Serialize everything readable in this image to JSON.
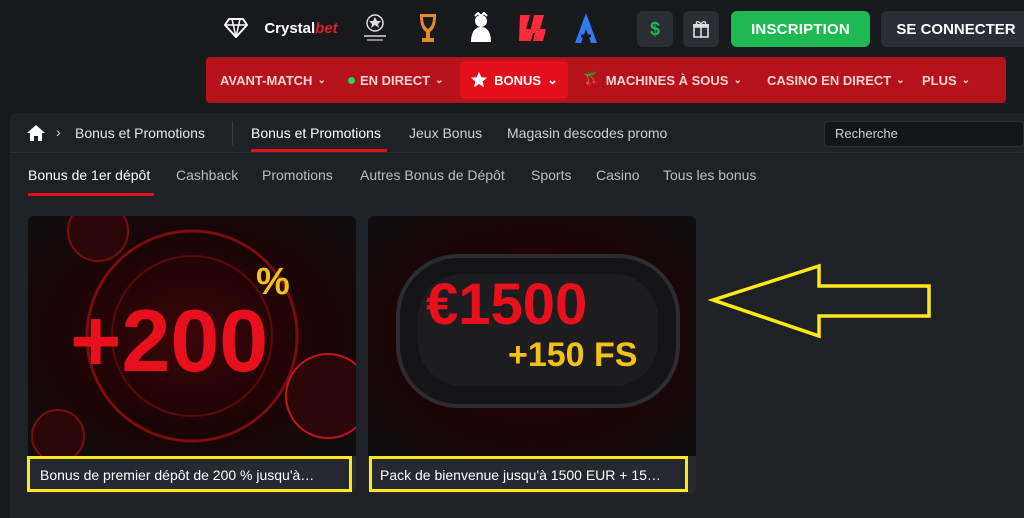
{
  "topbar": {
    "leagues": [
      "diamond-icon",
      "Crystal",
      "champions-league-icon",
      "europa-league-icon",
      "premier-league-icon",
      "laliga-icon",
      "serie-a-icon"
    ],
    "crystal_label": "Crystal",
    "crystal_suffix": "bet",
    "inscription_label": "INSCRIPTION",
    "connect_label": "SE CONNECTER"
  },
  "nav": {
    "items": [
      {
        "label": "AVANT-MATCH"
      },
      {
        "label": "EN DIRECT"
      },
      {
        "label": "BONUS"
      },
      {
        "label": "MACHINES À SOUS"
      },
      {
        "label": "CASINO EN DIRECT"
      },
      {
        "label": "PLUS"
      }
    ]
  },
  "breadcrumb": {
    "current": "Bonus et Promotions"
  },
  "tabs": {
    "items": [
      "Bonus et Promotions",
      "Jeux Bonus",
      "Magasin descodes promo"
    ]
  },
  "search": {
    "placeholder": "Recherche"
  },
  "subtabs": {
    "items": [
      "Bonus de 1er dépôt",
      "Cashback",
      "Promotions",
      "Autres Bonus de Dépôt",
      "Sports",
      "Casino",
      "Tous les bonus"
    ]
  },
  "cards": [
    {
      "title": "Bonus de premier dépôt de 200 % jusqu'à…",
      "img_text": "+200",
      "img_suffix": "%"
    },
    {
      "title": "Pack de bienvenue jusqu'à 1500 EUR + 15…",
      "img_text": "€1500",
      "img_sub": "+150 FS"
    }
  ],
  "colors": {
    "accent": "#e3101b",
    "highlight": "#ffe81a",
    "success": "#1fb954"
  }
}
